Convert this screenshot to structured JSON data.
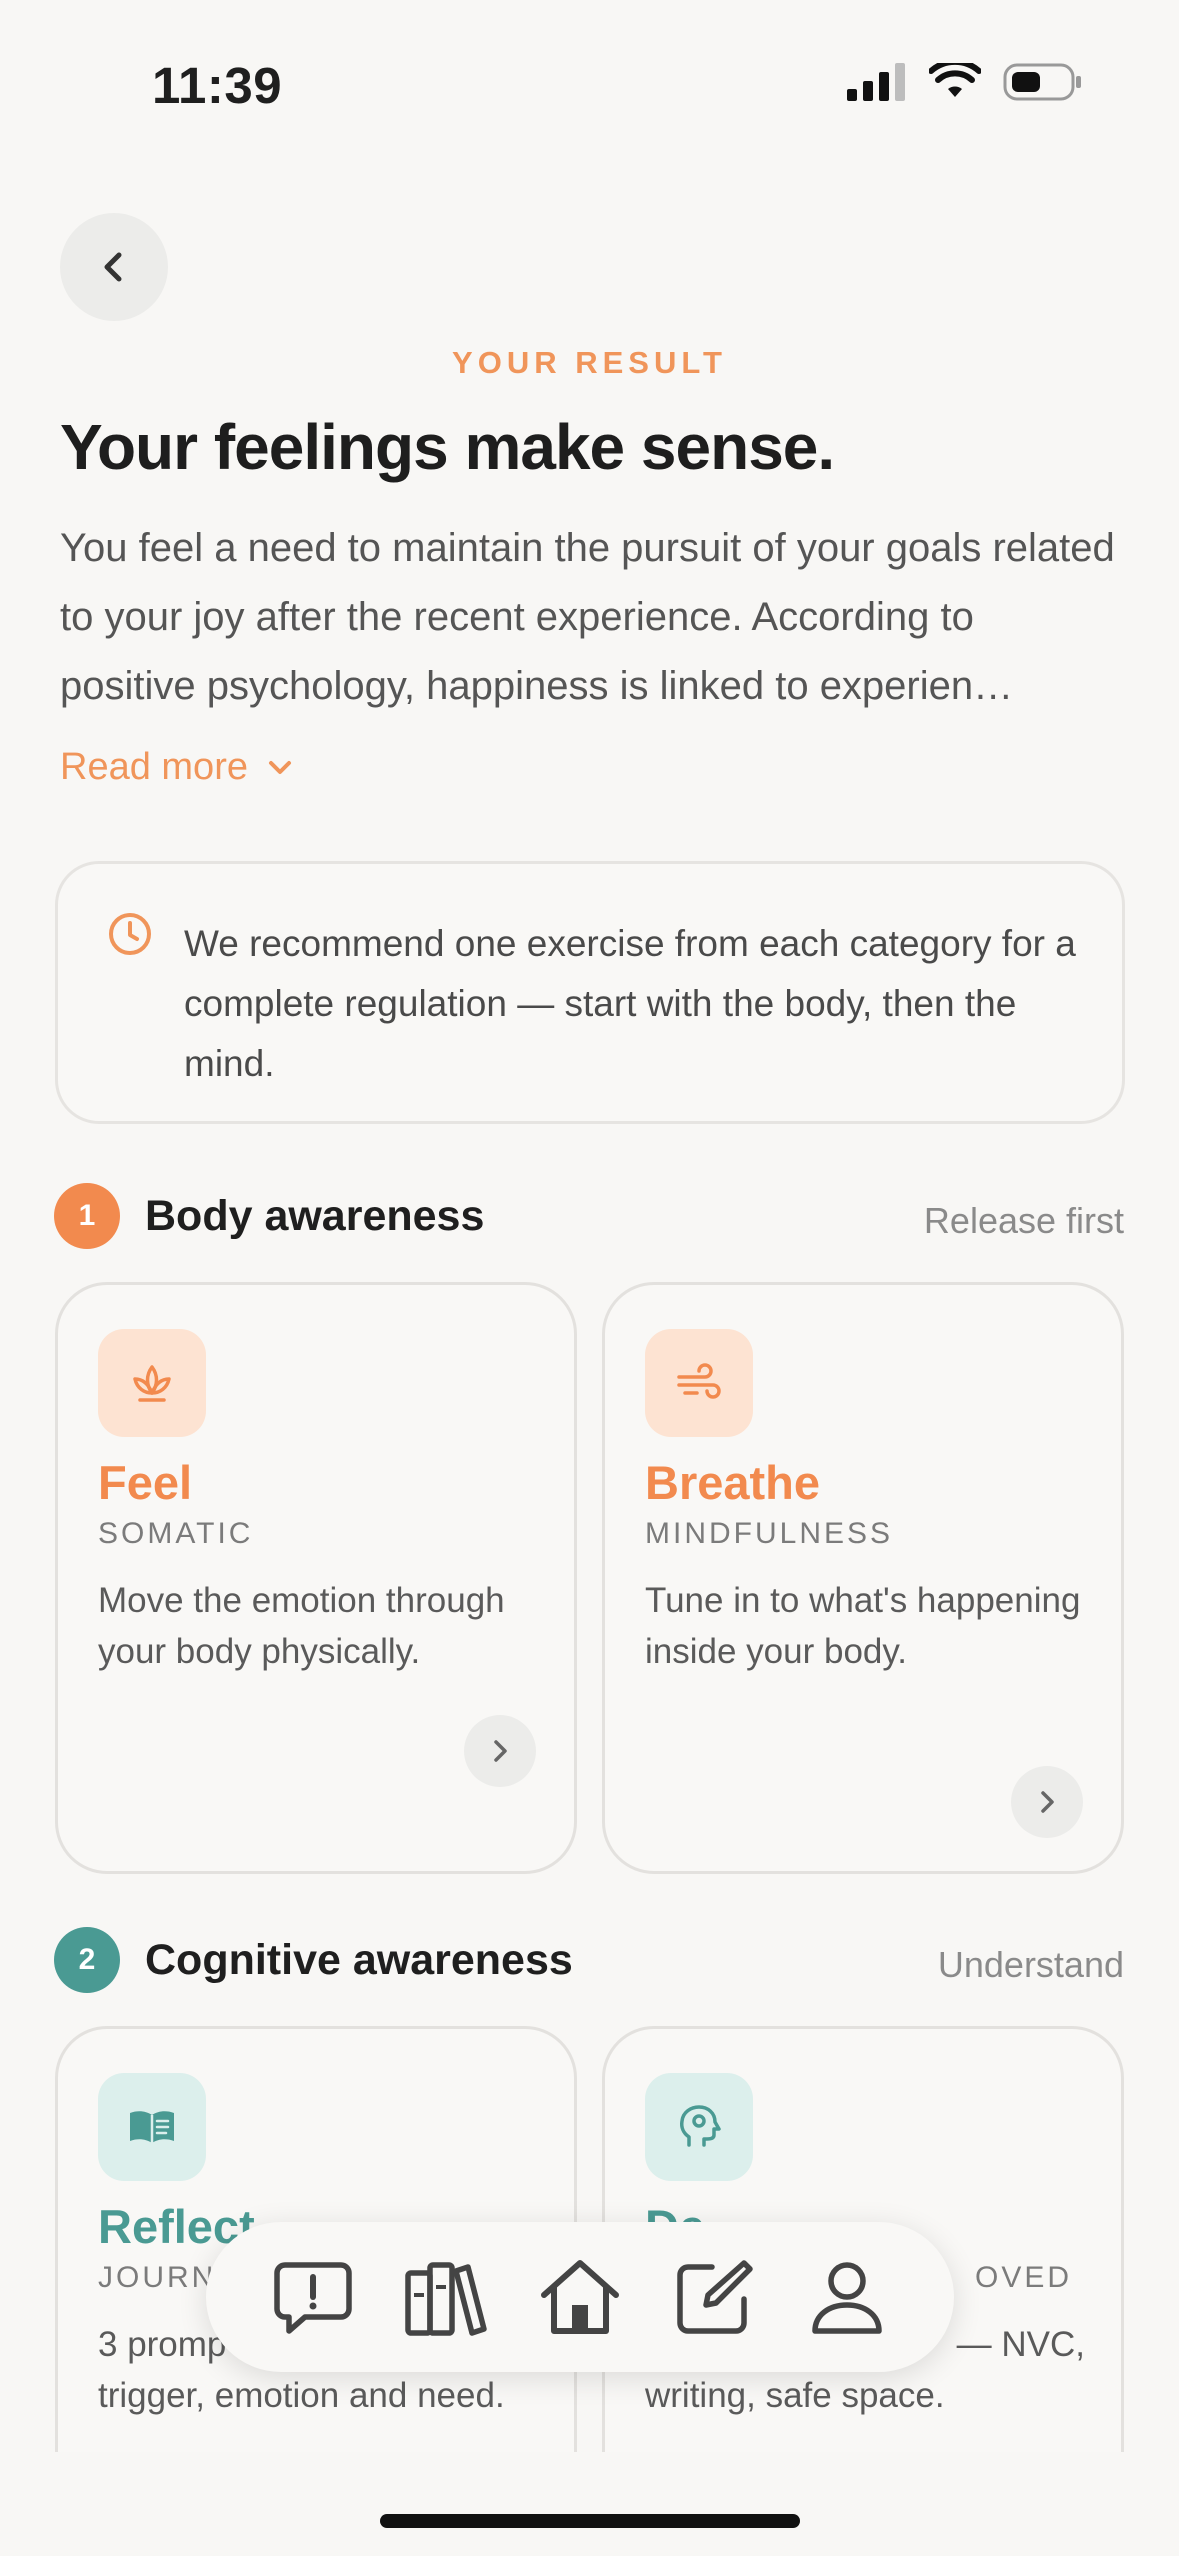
{
  "status_bar": {
    "time": "11:39"
  },
  "header": {
    "eyebrow": "YOUR RESULT",
    "title": "Your feelings make sense.",
    "body": "You feel a need to maintain the pursuit of your goals related to your joy after the recent experience. According to positive psychology, happiness is linked to experien…",
    "read_more": "Read more"
  },
  "info": {
    "text": "We recommend one exercise from each category for a complete regulation — start with the body, then the mind."
  },
  "sections": [
    {
      "number": "1",
      "title": "Body awareness",
      "aside": "Release first",
      "color": "#f28a4e",
      "cards": [
        {
          "title": "Feel",
          "category": "SOMATIC",
          "description": "Move the emotion through your body physically.",
          "icon": "lotus-icon"
        },
        {
          "title": "Breathe",
          "category": "MINDFULNESS",
          "description": "Tune in to what's happening inside your body.",
          "icon": "wind-icon"
        }
      ]
    },
    {
      "number": "2",
      "title": "Cognitive awareness",
      "aside": "Understand",
      "color": "#4a9a93",
      "cards": [
        {
          "title": "Reflect",
          "category": "JOURN",
          "description_a": "3 promp",
          "description_b": "trigger, emotion and need.",
          "icon": "book-icon"
        },
        {
          "title": "De",
          "category": "OVED",
          "description_a": "— NVC,",
          "description_b": "writing, safe space.",
          "icon": "head-gear-icon"
        }
      ]
    }
  ],
  "colors": {
    "accent": "#f0955a",
    "teal": "#4a9a93",
    "background": "#f8f7f5"
  },
  "tabbar": [
    "alert-chat-icon",
    "library-icon",
    "home-icon",
    "compose-icon",
    "profile-icon"
  ]
}
